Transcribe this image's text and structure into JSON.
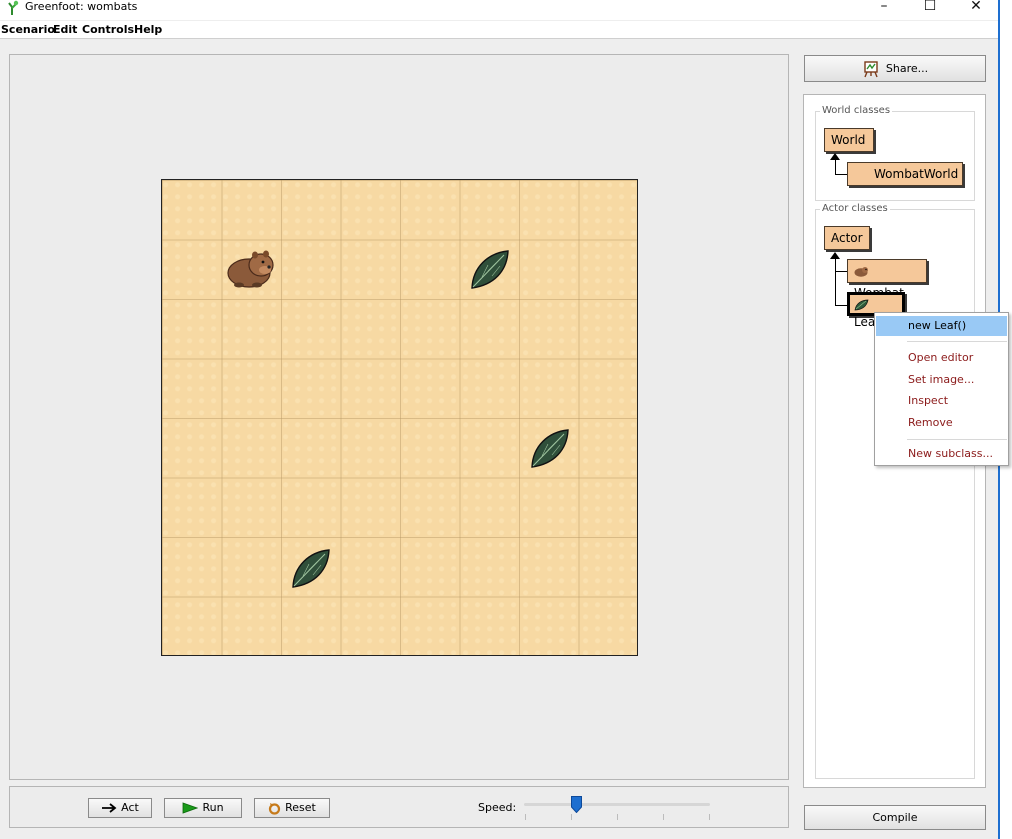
{
  "window": {
    "title": "Greenfoot: wombats",
    "min_glyph": "–",
    "max_glyph": "☐",
    "close_glyph": "✕"
  },
  "menu": {
    "items": [
      "Scenario",
      "Edit",
      "Controls",
      "Help"
    ]
  },
  "controls": {
    "act_label": "Act",
    "run_label": "Run",
    "reset_label": "Reset",
    "speed_label": "Speed:",
    "speed_value": 0.28
  },
  "sidebar": {
    "share_label": "Share...",
    "world_group_label": "World classes",
    "world_class": "World",
    "world_subclass": "WombatWorld",
    "actor_group_label": "Actor classes",
    "actor_class": "Actor",
    "actor_subclasses": [
      "Wombat",
      "Leaf"
    ],
    "compile_label": "Compile"
  },
  "context_menu": {
    "items": [
      "new Leaf()",
      "Open editor",
      "Set image...",
      "Inspect",
      "Remove",
      "New subclass..."
    ]
  },
  "world": {
    "grid_cols": 8,
    "grid_rows": 8,
    "actors": [
      {
        "type": "wombat",
        "col": 1,
        "row": 1
      },
      {
        "type": "leaf",
        "col": 5,
        "row": 1
      },
      {
        "type": "leaf",
        "col": 6,
        "row": 4
      },
      {
        "type": "leaf",
        "col": 2,
        "row": 6
      }
    ]
  },
  "colors": {
    "grid_background": "#f7d9a3",
    "class_box": "#f5c89a",
    "menu_highlight": "#99c9f5",
    "menu_text": "#8b1a1a",
    "slider_thumb": "#1e6fd0"
  }
}
